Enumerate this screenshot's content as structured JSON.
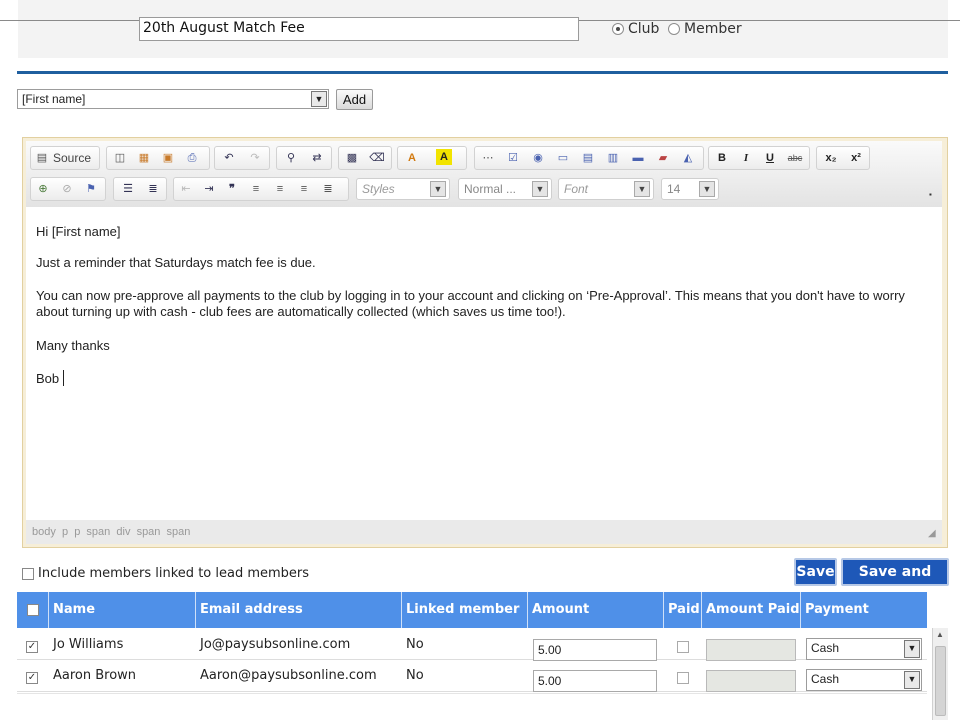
{
  "form": {
    "subject_value": "20th August Match Fee",
    "recipient_options": [
      "Club",
      "Member"
    ],
    "recipient_selected": "Club"
  },
  "merge_field": {
    "selected": "[First name]",
    "add_label": "Add"
  },
  "editor": {
    "toolbar": {
      "source_label": "Source",
      "styles_placeholder": "Styles",
      "format_value": "Normal ...",
      "font_placeholder": "Font",
      "size_value": "14"
    },
    "body": [
      "Hi [First name]",
      "Just a reminder that Saturdays match fee is due.",
      "You can now pre-approve all payments to the club by logging in to your account and clicking on ‘Pre-Approval’.  This means that you don't have to worry about turning up with cash - club fees are automatically collected (which saves us time too!).",
      "Many thanks",
      "Bob"
    ],
    "status_path": "body  p  p  span  div  span  span"
  },
  "options": {
    "include_linked_label": "Include members linked to lead members"
  },
  "actions": {
    "save_label": "Save",
    "save_send_label": "Save and Send"
  },
  "table": {
    "headers": [
      "Name",
      "Email address",
      "Linked member",
      "Amount requested",
      "Paid",
      "Amount Paid",
      "Payment Method"
    ],
    "rows": [
      {
        "checked": true,
        "name": "Jo Williams",
        "email": "Jo@paysubsonline.com",
        "linked": "No",
        "amount_requested": "5.00",
        "paid": false,
        "amount_paid": "",
        "method": "Cash"
      },
      {
        "checked": true,
        "name": "Aaron Brown",
        "email": "Aaron@paysubsonline.com",
        "linked": "No",
        "amount_requested": "5.00",
        "paid": false,
        "amount_paid": "",
        "method": "Cash"
      }
    ]
  },
  "colors": {
    "accent_blue": "#1e58b8",
    "table_header": "#4f90e8",
    "divider": "#1f5f9f"
  }
}
